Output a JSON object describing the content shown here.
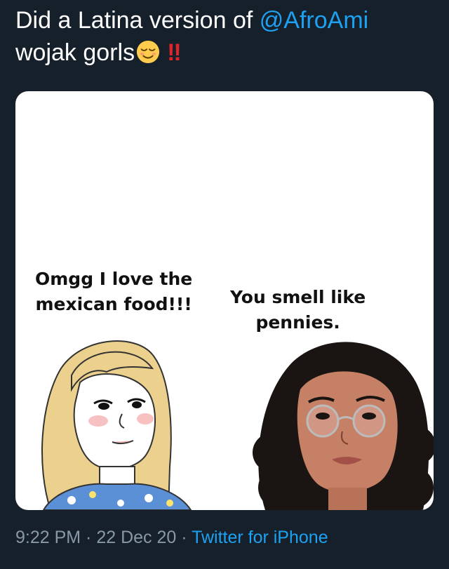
{
  "tweet": {
    "text_prefix": "Did a Latina version of ",
    "mention": "@AfroAmi",
    "text_line2": "wojak gorls",
    "emoji_relieved": "relieved-face-emoji",
    "emoji_bangbang": "‼"
  },
  "media": {
    "caption_left_line1": "Omgg I love the",
    "caption_left_line2": "mexican food!!!",
    "caption_right_line1": "You smell like",
    "caption_right_line2": "pennies."
  },
  "meta": {
    "time": "9:22 PM",
    "separator1": " · ",
    "date": "22 Dec 20",
    "separator2": " · ",
    "source": "Twitter for iPhone"
  },
  "colors": {
    "background": "#15202b",
    "link": "#1da1f2",
    "meta_gray": "#8899a6"
  }
}
